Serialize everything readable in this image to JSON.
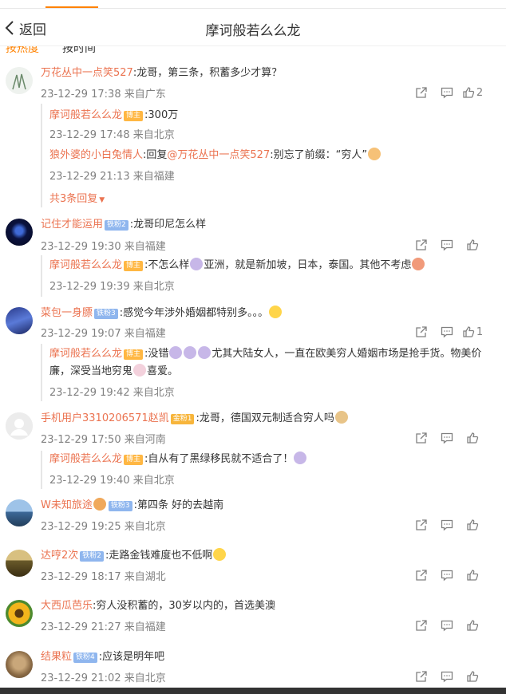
{
  "header": {
    "back_label": "返回",
    "title": "摩诃般若么么龙"
  },
  "sort": {
    "hot": "按热度",
    "time": "按时间"
  },
  "colors": {
    "username": "#eb7350",
    "accent": "#ff8200",
    "meta": "#808080"
  },
  "comments": [
    {
      "user": "万花丛中一点笑527",
      "text": ":龙哥，第三条，积蓄多少才算？",
      "time": "23-12-29 17:38 来自广东",
      "likes": "2",
      "avatar_icon": "sketch-avatar",
      "replies": [
        {
          "user": "摩诃般若么么龙",
          "badge": "博主",
          "text": ":300万",
          "time": "23-12-29 17:48 来自北京"
        },
        {
          "user": "狼外婆的小白兔情人",
          "text_pre": ":回复",
          "mention": "@万花丛中一点笑527",
          "text": ":别忘了前缀：“穷人”",
          "time": "23-12-29 21:13 来自福建"
        }
      ],
      "more": "共3条回复"
    },
    {
      "user": "记住才能运用",
      "badge": "铁粉2",
      "text": ":龙哥印尼怎么样",
      "time": "23-12-29 19:30 来自福建",
      "replies": [
        {
          "user": "摩诃般若么么龙",
          "badge": "博主",
          "text_a": ":不怎么样",
          "text_b": "亚洲，就是新加坡，日本，泰国。其他不考虑",
          "time": "23-12-29 19:39 来自北京"
        }
      ]
    },
    {
      "user": "菜包一身膘",
      "badge": "铁粉3",
      "text": ":感觉今年涉外婚姻都特别多。。。",
      "time": "23-12-29 19:07 来自福建",
      "likes": "1",
      "replies": [
        {
          "user": "摩诃般若么么龙",
          "badge": "博主",
          "text_a": ":没错",
          "text_b": "尤其大陆女人，一直在欧美穷人婚姻市场是抢手货。物美价",
          "text_c": "廉，深受当地穷鬼",
          "text_d": "喜爱。",
          "time": "23-12-29 19:42 来自北京"
        }
      ]
    },
    {
      "user": "手机用户3310206571赵凯",
      "badge": "金粉1",
      "text": ":龙哥，德国双元制适合穷人吗",
      "time": "23-12-29 17:50 来自河南",
      "replies": [
        {
          "user": "摩诃般若么么龙",
          "badge": "博主",
          "text": ":自从有了黑绿移民就不适合了！",
          "time": "23-12-29 19:40 来自北京"
        }
      ]
    },
    {
      "user": "W未知旅途",
      "badge": "铁粉3",
      "text": ":第四条 好的去越南",
      "time": "23-12-29 19:25 来自北京"
    },
    {
      "user": "达哼2次",
      "badge": "铁粉2",
      "text": ":走路金钱难度也不低啊",
      "time": "23-12-29 18:17 来自湖北"
    },
    {
      "user": "大西瓜芭乐",
      "text": ":穷人没积蓄的，30岁以内的，首选美澳",
      "time": "23-12-29 21:27 来自福建"
    },
    {
      "user": "结果粒",
      "badge": "铁粉4",
      "text": ":应该是明年吧",
      "time": "23-12-29 21:02 来自北京"
    }
  ]
}
